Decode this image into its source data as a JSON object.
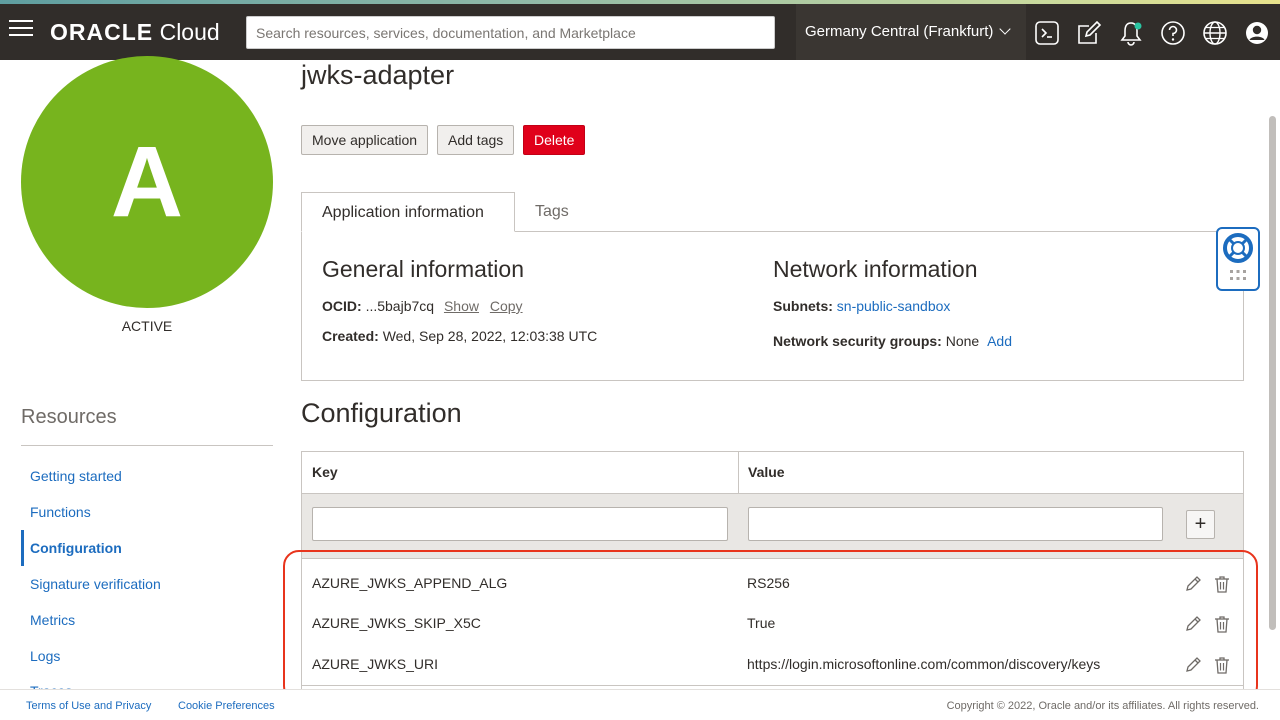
{
  "header": {
    "logo_brand": "ORACLE",
    "logo_product": "Cloud",
    "search_placeholder": "Search resources, services, documentation, and Marketplace",
    "region": "Germany Central (Frankfurt)",
    "icons": [
      "cloud-shell-icon",
      "edit-icon",
      "bell-icon",
      "help-icon",
      "globe-icon",
      "user-icon"
    ],
    "notification_dot_color": "#2ac5a2"
  },
  "sidebar": {
    "avatar_letter": "A",
    "avatar_color": "#77b41e",
    "status": "ACTIVE",
    "resources_title": "Resources",
    "items": [
      {
        "label": "Getting started"
      },
      {
        "label": "Functions"
      },
      {
        "label": "Configuration",
        "active": true
      },
      {
        "label": "Signature verification"
      },
      {
        "label": "Metrics"
      },
      {
        "label": "Logs"
      },
      {
        "label": "Traces"
      }
    ]
  },
  "main": {
    "title": "jwks-adapter",
    "buttons": {
      "move": "Move application",
      "tags": "Add tags",
      "delete": "Delete"
    },
    "tabs": [
      {
        "label": "Application information",
        "active": true
      },
      {
        "label": "Tags"
      }
    ],
    "general": {
      "title": "General information",
      "ocid_label": "OCID:",
      "ocid_value": "...5bajb7cq",
      "show": "Show",
      "copy": "Copy",
      "created_label": "Created:",
      "created_value": "Wed, Sep 28, 2022, 12:03:38 UTC"
    },
    "network": {
      "title": "Network information",
      "subnets_label": "Subnets:",
      "subnets_value": "sn-public-sandbox",
      "nsg_label": "Network security groups:",
      "nsg_value": "None",
      "nsg_add": "Add"
    },
    "configuration": {
      "title": "Configuration",
      "columns": [
        "Key",
        "Value"
      ],
      "key_input_value": "",
      "value_input_value": "",
      "rows": [
        {
          "key": "AZURE_JWKS_APPEND_ALG",
          "value": "RS256"
        },
        {
          "key": "AZURE_JWKS_SKIP_X5C",
          "value": "True"
        },
        {
          "key": "AZURE_JWKS_URI",
          "value": "https://login.microsoftonline.com/common/discovery/keys"
        }
      ]
    }
  },
  "footer": {
    "terms": "Terms of Use and Privacy",
    "cookies": "Cookie Preferences",
    "copyright": "Copyright © 2022, Oracle and/or its affiliates. All rights reserved."
  },
  "colors": {
    "header_bg": "#312d2a",
    "link": "#1c6cbf",
    "delete": "#e0001a",
    "highlight": "#e8341c"
  }
}
